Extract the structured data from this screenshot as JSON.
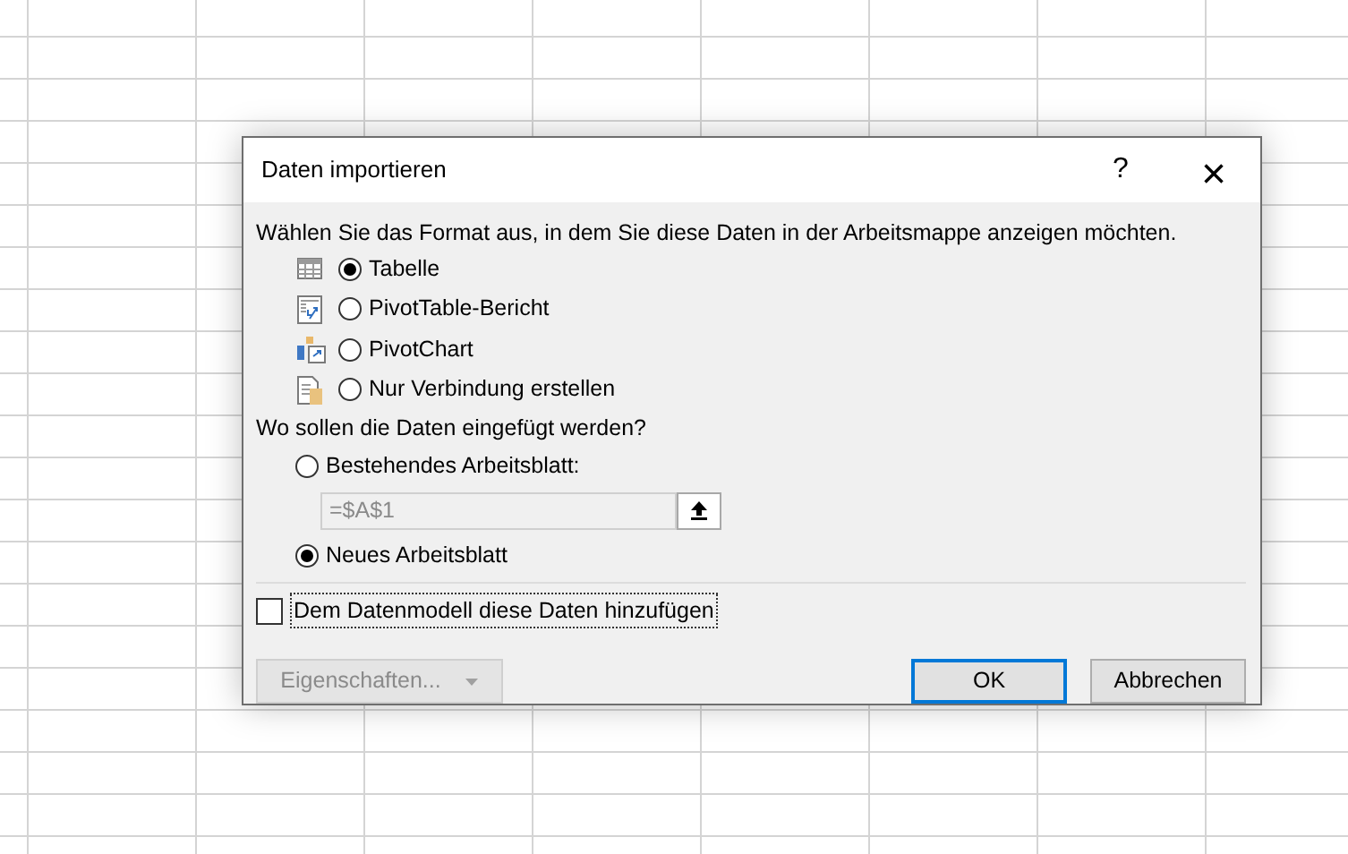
{
  "dialog": {
    "title": "Daten importieren",
    "help": "?",
    "close": "×"
  },
  "format_prompt": "Wählen Sie das Format aus, in dem Sie diese Daten in der Arbeitsmappe anzeigen möchten.",
  "formats": [
    {
      "kind": "table",
      "label": "Tabelle",
      "selected": true
    },
    {
      "kind": "pivottable",
      "label": "PivotTable-Bericht",
      "selected": false
    },
    {
      "kind": "pivotchart",
      "label": "PivotChart",
      "selected": false
    },
    {
      "kind": "connection",
      "label": "Nur Verbindung erstellen",
      "selected": false
    }
  ],
  "location_prompt": "Wo sollen die Daten eingefügt werden?",
  "locations": [
    {
      "kind": "existing",
      "label": "Bestehendes Arbeitsblatt:",
      "selected": false,
      "value": "=$A$1",
      "disabled": true
    },
    {
      "kind": "new",
      "label": "Neues Arbeitsblatt",
      "selected": true
    }
  ],
  "data_model": {
    "label": "Dem Datenmodell diese Daten hinzufügen",
    "checked": false
  },
  "buttons": [
    {
      "kind": "properties",
      "label": "Eigenschaften...",
      "disabled": true
    },
    {
      "kind": "ok",
      "label": "OK",
      "default": true
    },
    {
      "kind": "cancel",
      "label": "Abbrechen"
    }
  ]
}
